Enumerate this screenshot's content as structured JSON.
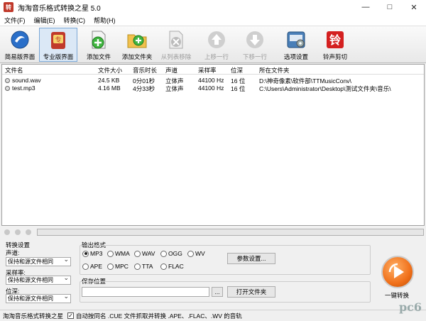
{
  "window": {
    "title": "淘淘音乐格式转换之星 5.0",
    "icon_text": "转"
  },
  "menu": [
    "文件(F)",
    "编辑(E)",
    "转换(C)",
    "帮助(H)"
  ],
  "toolbar": {
    "simple_view": "简易版界面",
    "pro_view": "专业版界面",
    "add_file": "添加文件",
    "add_folder": "添加文件夹",
    "remove": "从列表移除",
    "move_up": "上移一行",
    "move_down": "下移一行",
    "options": "选项设置",
    "ringtone": "铃声剪切",
    "ringtone_icon_text": "铃"
  },
  "table": {
    "headers": [
      "文件名",
      "文件大小",
      "音乐时长",
      "声道",
      "采样率",
      "位深",
      "所在文件夹"
    ],
    "rows": [
      [
        "sound.wav",
        "24.5 KB",
        "0分01秒",
        "立体声",
        "44100 Hz",
        "16 位",
        "D:\\神奇像素\\软件部\\TTMusicConv\\"
      ],
      [
        "test.mp3",
        "4.16 MB",
        "4分33秒",
        "立体声",
        "44100 Hz",
        "16 位",
        "C:\\Users\\Administrator\\Desktop\\测试文件夹\\音乐\\"
      ]
    ]
  },
  "progress": {
    "value": 0
  },
  "convert_settings": {
    "title": "转换设置",
    "channel_label": "声道:",
    "channel_value": "保持和源文件相同",
    "samplerate_label": "采样率:",
    "samplerate_value": "保持和源文件相同",
    "bitdepth_label": "位深:",
    "bitdepth_value": "保持和源文件相同"
  },
  "output_format": {
    "title": "输出格式",
    "formats": [
      "MP3",
      "WMA",
      "WAV",
      "OGG",
      "WV",
      "APE",
      "MPC",
      "TTA",
      "FLAC"
    ],
    "selected": "MP3",
    "params_button": "参数设置..."
  },
  "save_location": {
    "title": "保存位置",
    "path": "",
    "browse_button": "...",
    "open_folder_button": "打开文件夹"
  },
  "one_click": {
    "label": "一键转换"
  },
  "statusbar": {
    "app_name": "淘淘音乐格式转换之星",
    "checkbox_checked": true,
    "checkbox_mark": "✓",
    "option_text": "自动按同名 .CUE 文件抓取并转换 .APE、.FLAC、.WV 的音轨"
  },
  "watermark": "pc6"
}
